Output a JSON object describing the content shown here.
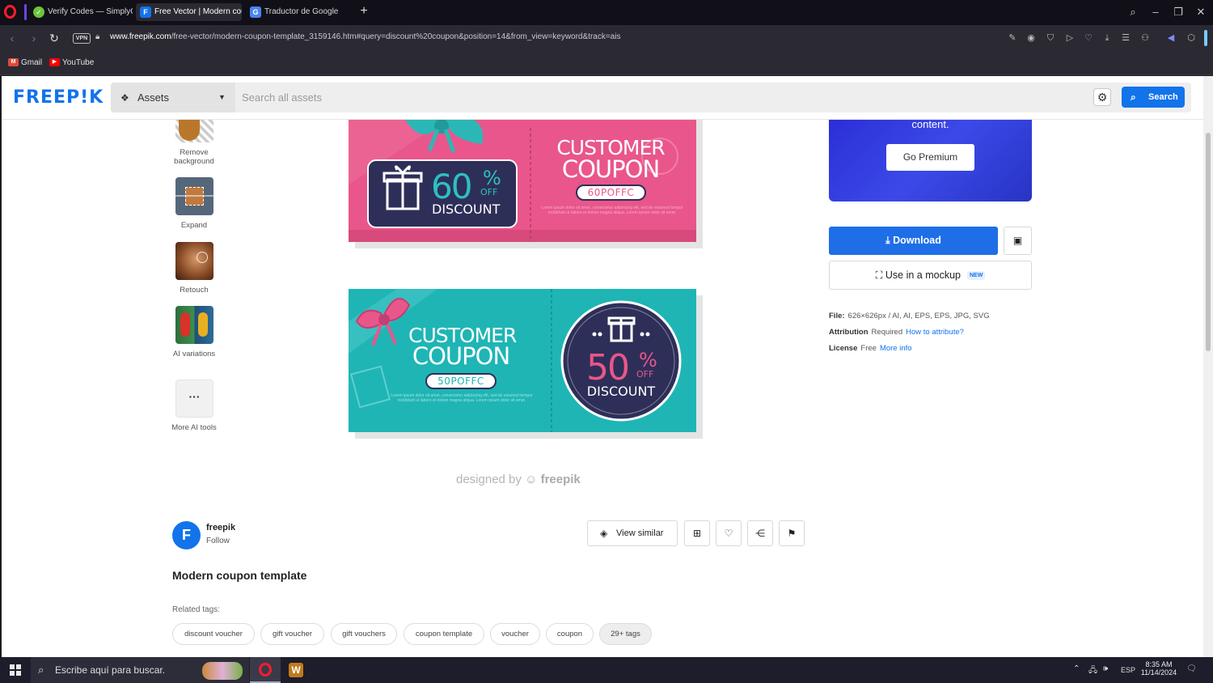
{
  "browser": {
    "tabs": [
      {
        "label": "Verify Codes — SimplyCo",
        "favicon": "check-icon"
      },
      {
        "label": "Free Vector | Modern cou",
        "favicon": "freepik-icon"
      },
      {
        "label": "Traductor de Google",
        "favicon": "translate-icon"
      }
    ],
    "url_domain": "www.freepik.com",
    "url_path": "/free-vector/modern-coupon-template_3159146.htm#query=discount%20coupon&position=14&from_view=keyword&track=ais",
    "vpn_label": "VPN",
    "bookmarks": [
      {
        "label": "Gmail",
        "icon": "gmail-icon"
      },
      {
        "label": "YouTube",
        "icon": "youtube-icon"
      }
    ]
  },
  "header": {
    "logo": "FREEP!K",
    "assets_label": "Assets",
    "search_placeholder": "Search all assets",
    "search_button": "Search"
  },
  "ai_tools": [
    {
      "label": "Remove background"
    },
    {
      "label": "Expand"
    },
    {
      "label": "Retouch"
    },
    {
      "label": "AI variations"
    },
    {
      "label": "More AI tools"
    }
  ],
  "coupons": {
    "pink": {
      "title_line1": "CUSTOMER",
      "title_line2": "COUPON",
      "code": "60POFFC",
      "percent": "60",
      "percent_sign": "%",
      "off": "OFF",
      "discount": "DISCOUNT",
      "fine": "Lorem ipsum dolor sit amet, consectetur adipiscing elit, sed do eiusmod tempor incididunt ut labore et dolore magna aliqua. Lorem ipsum dolor sit amet."
    },
    "teal": {
      "title_line1": "CUSTOMER",
      "title_line2": "COUPON",
      "code": "50POFFC",
      "percent": "50",
      "percent_sign": "%",
      "off": "OFF",
      "discount": "DISCOUNT",
      "fine": "Lorem ipsum dolor sit amet, consectetur adipiscing elit, sed do eiusmod tempor incididunt ut labore et dolore magna aliqua. Lorem ipsum dolor sit amet."
    },
    "designed_by": "designed by",
    "designed_brand": "freepik"
  },
  "sidebar_right": {
    "premium_text": "content.",
    "go_premium": "Go Premium",
    "download": "Download",
    "mockup": "Use in a mockup",
    "mockup_badge": "NEW",
    "file_label": "File:",
    "file_value": "626×626px / AI, AI, EPS, EPS, JPG, SVG",
    "attribution_label": "Attribution",
    "attribution_value": "Required",
    "attribution_link": "How to attribute?",
    "license_label": "License",
    "license_value": "Free",
    "license_link": "More info"
  },
  "author": {
    "initial": "F",
    "name": "freepik",
    "follow": "Follow"
  },
  "actions": {
    "view_similar": "View similar"
  },
  "resource_title": "Modern coupon template",
  "related_label": "Related tags:",
  "tags": [
    "discount voucher",
    "gift voucher",
    "gift vouchers",
    "coupon template",
    "voucher",
    "coupon",
    "29+ tags"
  ],
  "taskbar": {
    "search_placeholder": "Escribe aquí para buscar.",
    "lang": "ESP",
    "time": "8:35 AM",
    "date": "11/14/2024"
  },
  "colors": {
    "brand": "#1273eb",
    "coupon_pink": "#e8568a",
    "coupon_teal": "#1fb5b5",
    "coupon_navy": "#2d2f55"
  }
}
